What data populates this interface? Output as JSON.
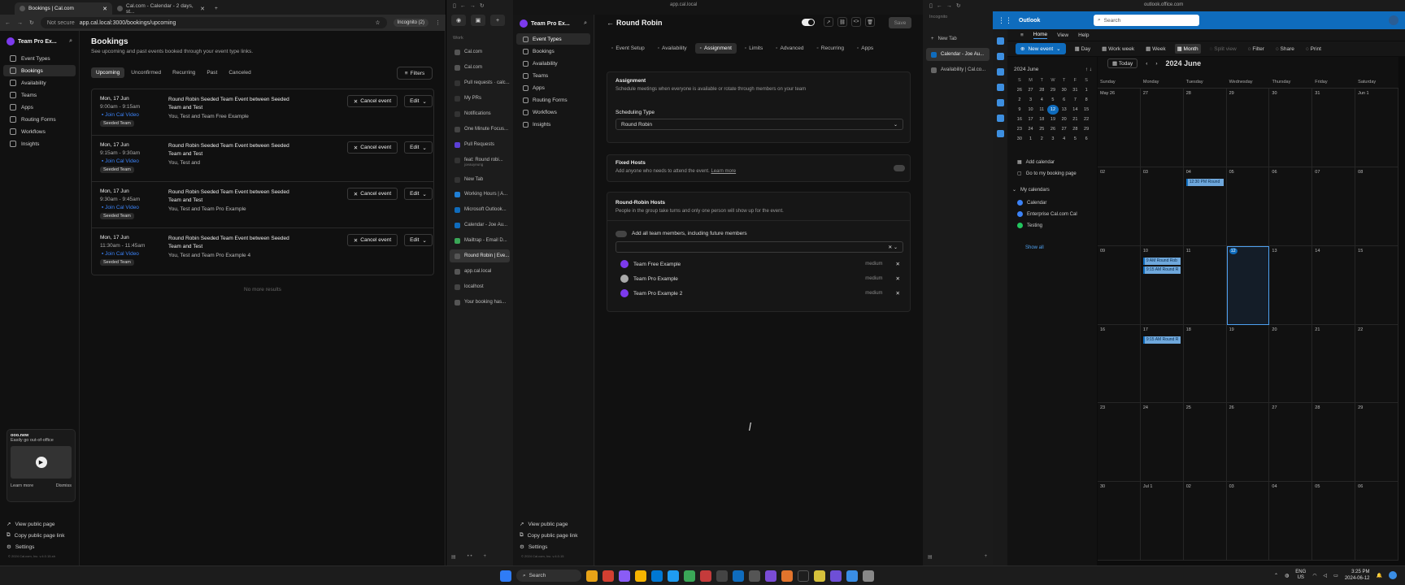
{
  "w1": {
    "tabs": [
      {
        "label": "Bookings | Cal.com"
      },
      {
        "label": "Cal.com - Calendar - 2 days, st..."
      }
    ],
    "address": {
      "security": "Not secure",
      "url": "app.cal.local:3000/bookings/upcoming",
      "incognito": "Incognito (2)"
    },
    "team_name": "Team Pro Ex...",
    "nav": [
      "Event Types",
      "Bookings",
      "Availability",
      "Teams",
      "Apps",
      "Routing Forms",
      "Workflows",
      "Insights"
    ],
    "title": "Bookings",
    "subtitle": "See upcoming and past events booked through your event type links.",
    "tabs_b": [
      "Upcoming",
      "Unconfirmed",
      "Recurring",
      "Past",
      "Canceled"
    ],
    "filters": "Filters",
    "bookings": [
      {
        "date": "Mon, 17 Jun",
        "time": "9:00am - 9:15am",
        "video": "Join Cal Video",
        "badge": "Seeded Team",
        "title": "Round Robin Seeded Team Event between Seeded Team and Test",
        "attendees": "You, Test and Team Free Example"
      },
      {
        "date": "Mon, 17 Jun",
        "time": "9:15am - 9:30am",
        "video": "Join Cal Video",
        "badge": "Seeded Team",
        "title": "Round Robin Seeded Team Event between Seeded Team and Test",
        "attendees": "You, Test and"
      },
      {
        "date": "Mon, 17 Jun",
        "time": "9:30am - 9:45am",
        "video": "Join Cal Video",
        "badge": "Seeded Team",
        "title": "Round Robin Seeded Team Event between Seeded Team and Test",
        "attendees": "You, Test and Team Pro Example"
      },
      {
        "date": "Mon, 17 Jun",
        "time": "11:30am - 11:45am",
        "video": "Join Cal Video",
        "badge": "Seeded Team",
        "title": "Round Robin Seeded Team Event between Seeded Team and Test",
        "attendees": "You, Test and Team Pro Example 4"
      }
    ],
    "cancel_label": "Cancel event",
    "edit_label": "Edit",
    "no_more": "No more results",
    "promo": {
      "brand": "ooo.new",
      "text": "Easily go out-of-office",
      "learn": "Learn more",
      "dismiss": "Dismiss"
    },
    "footer": [
      "View public page",
      "Copy public page link",
      "Settings"
    ],
    "copyright": "© 2024 Cal.com, Inc. v.4.0.15-sh"
  },
  "w2": {
    "url": "app.cal.local",
    "arc_label": "Work",
    "arc_items": [
      "Cal.com",
      "Cal.com",
      "Pull requests · calc...",
      "My PRs",
      "Notifications",
      "One Minute Focus...",
      "Pull Requests",
      "feat: Round robi...",
      "New Tab",
      "Working Hours | A...",
      "Microsoft Outlook...",
      "Calendar - Joe Au...",
      "Mailtrap - Email D...",
      "Round Robin | Eve...",
      "app.cal.local",
      "localhost",
      "Your booking has..."
    ],
    "pr_sub": "joeauyeung",
    "team_name": "Team Pro Ex...",
    "nav": [
      "Event Types",
      "Bookings",
      "Availability",
      "Teams",
      "Apps",
      "Routing Forms",
      "Workflows",
      "Insights"
    ],
    "footer": [
      "View public page",
      "Copy public page link",
      "Settings"
    ],
    "copyright": "© 2024 Cal.com, Inc. v.4.0.15",
    "event_title": "Round Robin",
    "save": "Save",
    "tabs": [
      "Event Setup",
      "Availability",
      "Assignment",
      "Limits",
      "Advanced",
      "Recurring",
      "Apps"
    ],
    "assignment": {
      "title": "Assignment",
      "sub": "Schedule meetings when everyone is available or rotate through members on your team"
    },
    "scheduling": {
      "label": "Scheduling Type",
      "value": "Round Robin"
    },
    "fixed": {
      "title": "Fixed Hosts",
      "sub": "Add anyone who needs to attend the event.",
      "learn": "Learn more"
    },
    "rr": {
      "title": "Round-Robin Hosts",
      "sub": "People in the group take turns and only one person will show up for the event.",
      "add_all": "Add all team members, including future members"
    },
    "hosts": [
      {
        "name": "Team Free Example",
        "priority": "medium"
      },
      {
        "name": "Team Pro Example",
        "priority": "medium"
      },
      {
        "name": "Team Pro Example 2",
        "priority": "medium"
      }
    ]
  },
  "w3": {
    "label": "Incognito",
    "new_tab": "New Tab",
    "tabs": [
      "Calendar - Joe Au...",
      "Availability | Cal.co..."
    ],
    "url": "outlook.office.com",
    "app": "Outlook",
    "search": "Search",
    "ribbon_tabs": [
      "Home",
      "View",
      "Help"
    ],
    "new_event": "New event",
    "views": [
      "Day",
      "Work week",
      "Week",
      "Month"
    ],
    "actions": [
      "Split view",
      "Filter",
      "Share",
      "Print"
    ],
    "mini_month": "2024 June",
    "mini_dow": [
      "S",
      "M",
      "T",
      "W",
      "T",
      "F",
      "S"
    ],
    "mini_days": [
      [
        "26",
        "27",
        "28",
        "29",
        "30",
        "31",
        "1"
      ],
      [
        "2",
        "3",
        "4",
        "5",
        "6",
        "7",
        "8"
      ],
      [
        "9",
        "10",
        "11",
        "12",
        "13",
        "14",
        "15"
      ],
      [
        "16",
        "17",
        "18",
        "19",
        "20",
        "21",
        "22"
      ],
      [
        "23",
        "24",
        "25",
        "26",
        "27",
        "28",
        "29"
      ],
      [
        "30",
        "1",
        "2",
        "3",
        "4",
        "5",
        "6"
      ]
    ],
    "add_calendar": "Add calendar",
    "booking_page": "Go to my booking page",
    "my_calendars": "My calendars",
    "calendars": [
      {
        "name": "Calendar",
        "color": "#3b82f6"
      },
      {
        "name": "Enterprise Cal.com Cal",
        "color": "#3b82f6"
      },
      {
        "name": "Testing",
        "color": "#22c55e"
      }
    ],
    "show_all": "Show all",
    "today": "Today",
    "month_title": "2024 June",
    "dow": [
      "Sunday",
      "Monday",
      "Tuesday",
      "Wednesday",
      "Thursday",
      "Friday",
      "Saturday"
    ],
    "weeks": [
      [
        "May 26",
        "27",
        "28",
        "29",
        "30",
        "31",
        "Jun 1"
      ],
      [
        "02",
        "03",
        "04",
        "05",
        "06",
        "07",
        "08"
      ],
      [
        "09",
        "10",
        "11",
        "12",
        "13",
        "14",
        "15"
      ],
      [
        "16",
        "17",
        "18",
        "19",
        "20",
        "21",
        "22"
      ],
      [
        "23",
        "24",
        "25",
        "26",
        "27",
        "28",
        "29"
      ],
      [
        "30",
        "Jul 1",
        "02",
        "03",
        "04",
        "05",
        "06"
      ]
    ],
    "events": [
      {
        "week": 1,
        "day": 2,
        "slot": 0,
        "label": "12:30 PM Round"
      },
      {
        "week": 2,
        "day": 1,
        "slot": 0,
        "label": "9 AM Round Rob"
      },
      {
        "week": 2,
        "day": 1,
        "slot": 1,
        "label": "9:15 AM Round R"
      },
      {
        "week": 3,
        "day": 1,
        "slot": 0,
        "label": "9:15 AM Round R"
      }
    ]
  },
  "taskbar": {
    "search": "Search",
    "lang": "ENG",
    "region": "US",
    "time": "3:25 PM",
    "date": "2024-06-12"
  }
}
